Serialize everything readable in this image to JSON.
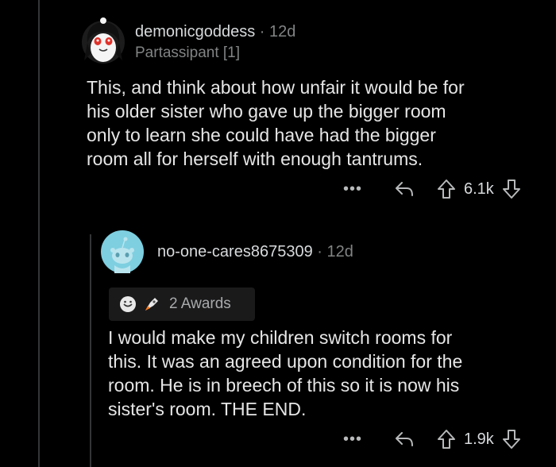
{
  "comment1": {
    "username": "demonicgoddess",
    "separator": "·",
    "age": "12d",
    "flair": "Partassipant [1]",
    "avatar": "snoo-avatar-dark-hair-red-eyes",
    "body_lines": [
      "This, and think about how unfair it would be for",
      "his older sister who gave up the bigger room",
      "only to learn she could have had the bigger",
      "room all for herself with enough tantrums."
    ],
    "actions": {
      "more": "•••",
      "score": "6.1k",
      "icons": [
        "more-icon",
        "reply-icon",
        "upvote-icon",
        "downvote-icon"
      ]
    }
  },
  "comment2": {
    "username": "no-one-cares8675309",
    "separator": "·",
    "age": "12d",
    "avatar": "default-snoo-avatar-light-blue",
    "awards": {
      "label": "2 Awards",
      "icons": [
        "wholesome-award-icon",
        "rocket-like-award-icon"
      ]
    },
    "body_lines": [
      "I would make my children switch rooms for",
      "this. It was an agreed upon condition for the",
      "room. He is in breech of this so it is now his",
      "sister's room. THE END."
    ],
    "actions": {
      "more": "•••",
      "score": "1.9k",
      "icons": [
        "more-icon",
        "reply-icon",
        "upvote-icon",
        "downvote-icon"
      ]
    }
  },
  "colors": {
    "background": "#000000",
    "text": "#e6e6e6",
    "meta": "#818384",
    "thread_line": "#343536",
    "award_bg": "#1a1a1b",
    "avatar2_bg": "#7ecfe0"
  }
}
